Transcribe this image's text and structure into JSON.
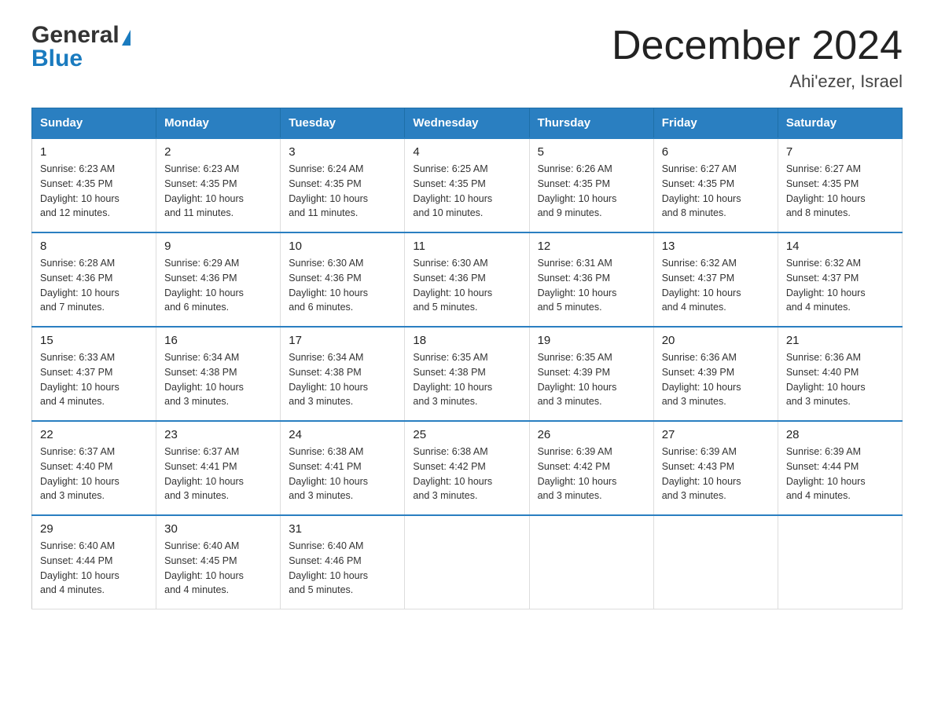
{
  "header": {
    "logo_general": "General",
    "logo_blue": "Blue",
    "month_title": "December 2024",
    "location": "Ahi'ezer, Israel"
  },
  "weekdays": [
    "Sunday",
    "Monday",
    "Tuesday",
    "Wednesday",
    "Thursday",
    "Friday",
    "Saturday"
  ],
  "weeks": [
    [
      {
        "day": "1",
        "sunrise": "6:23 AM",
        "sunset": "4:35 PM",
        "daylight": "10 hours and 12 minutes."
      },
      {
        "day": "2",
        "sunrise": "6:23 AM",
        "sunset": "4:35 PM",
        "daylight": "10 hours and 11 minutes."
      },
      {
        "day": "3",
        "sunrise": "6:24 AM",
        "sunset": "4:35 PM",
        "daylight": "10 hours and 11 minutes."
      },
      {
        "day": "4",
        "sunrise": "6:25 AM",
        "sunset": "4:35 PM",
        "daylight": "10 hours and 10 minutes."
      },
      {
        "day": "5",
        "sunrise": "6:26 AM",
        "sunset": "4:35 PM",
        "daylight": "10 hours and 9 minutes."
      },
      {
        "day": "6",
        "sunrise": "6:27 AM",
        "sunset": "4:35 PM",
        "daylight": "10 hours and 8 minutes."
      },
      {
        "day": "7",
        "sunrise": "6:27 AM",
        "sunset": "4:35 PM",
        "daylight": "10 hours and 8 minutes."
      }
    ],
    [
      {
        "day": "8",
        "sunrise": "6:28 AM",
        "sunset": "4:36 PM",
        "daylight": "10 hours and 7 minutes."
      },
      {
        "day": "9",
        "sunrise": "6:29 AM",
        "sunset": "4:36 PM",
        "daylight": "10 hours and 6 minutes."
      },
      {
        "day": "10",
        "sunrise": "6:30 AM",
        "sunset": "4:36 PM",
        "daylight": "10 hours and 6 minutes."
      },
      {
        "day": "11",
        "sunrise": "6:30 AM",
        "sunset": "4:36 PM",
        "daylight": "10 hours and 5 minutes."
      },
      {
        "day": "12",
        "sunrise": "6:31 AM",
        "sunset": "4:36 PM",
        "daylight": "10 hours and 5 minutes."
      },
      {
        "day": "13",
        "sunrise": "6:32 AM",
        "sunset": "4:37 PM",
        "daylight": "10 hours and 4 minutes."
      },
      {
        "day": "14",
        "sunrise": "6:32 AM",
        "sunset": "4:37 PM",
        "daylight": "10 hours and 4 minutes."
      }
    ],
    [
      {
        "day": "15",
        "sunrise": "6:33 AM",
        "sunset": "4:37 PM",
        "daylight": "10 hours and 4 minutes."
      },
      {
        "day": "16",
        "sunrise": "6:34 AM",
        "sunset": "4:38 PM",
        "daylight": "10 hours and 3 minutes."
      },
      {
        "day": "17",
        "sunrise": "6:34 AM",
        "sunset": "4:38 PM",
        "daylight": "10 hours and 3 minutes."
      },
      {
        "day": "18",
        "sunrise": "6:35 AM",
        "sunset": "4:38 PM",
        "daylight": "10 hours and 3 minutes."
      },
      {
        "day": "19",
        "sunrise": "6:35 AM",
        "sunset": "4:39 PM",
        "daylight": "10 hours and 3 minutes."
      },
      {
        "day": "20",
        "sunrise": "6:36 AM",
        "sunset": "4:39 PM",
        "daylight": "10 hours and 3 minutes."
      },
      {
        "day": "21",
        "sunrise": "6:36 AM",
        "sunset": "4:40 PM",
        "daylight": "10 hours and 3 minutes."
      }
    ],
    [
      {
        "day": "22",
        "sunrise": "6:37 AM",
        "sunset": "4:40 PM",
        "daylight": "10 hours and 3 minutes."
      },
      {
        "day": "23",
        "sunrise": "6:37 AM",
        "sunset": "4:41 PM",
        "daylight": "10 hours and 3 minutes."
      },
      {
        "day": "24",
        "sunrise": "6:38 AM",
        "sunset": "4:41 PM",
        "daylight": "10 hours and 3 minutes."
      },
      {
        "day": "25",
        "sunrise": "6:38 AM",
        "sunset": "4:42 PM",
        "daylight": "10 hours and 3 minutes."
      },
      {
        "day": "26",
        "sunrise": "6:39 AM",
        "sunset": "4:42 PM",
        "daylight": "10 hours and 3 minutes."
      },
      {
        "day": "27",
        "sunrise": "6:39 AM",
        "sunset": "4:43 PM",
        "daylight": "10 hours and 3 minutes."
      },
      {
        "day": "28",
        "sunrise": "6:39 AM",
        "sunset": "4:44 PM",
        "daylight": "10 hours and 4 minutes."
      }
    ],
    [
      {
        "day": "29",
        "sunrise": "6:40 AM",
        "sunset": "4:44 PM",
        "daylight": "10 hours and 4 minutes."
      },
      {
        "day": "30",
        "sunrise": "6:40 AM",
        "sunset": "4:45 PM",
        "daylight": "10 hours and 4 minutes."
      },
      {
        "day": "31",
        "sunrise": "6:40 AM",
        "sunset": "4:46 PM",
        "daylight": "10 hours and 5 minutes."
      },
      null,
      null,
      null,
      null
    ]
  ]
}
